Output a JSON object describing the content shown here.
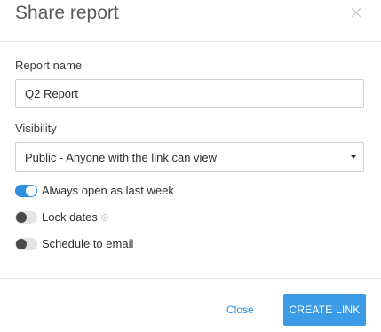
{
  "dialog": {
    "title": "Share report",
    "close_icon": "close-icon"
  },
  "report_name": {
    "label": "Report name",
    "value": "Q2 Report"
  },
  "visibility": {
    "label": "Visibility",
    "selected": "Public - Anyone with the link can view"
  },
  "toggles": [
    {
      "label": "Always open as last week",
      "on": true
    },
    {
      "label": "Lock dates",
      "on": false,
      "info_icon": "info-icon"
    },
    {
      "label": "Schedule to email",
      "on": false
    }
  ],
  "footer": {
    "close_label": "Close",
    "create_label": "CREATE LINK"
  },
  "colors": {
    "accent": "#2f8ee0",
    "button": "#3c9be6"
  }
}
